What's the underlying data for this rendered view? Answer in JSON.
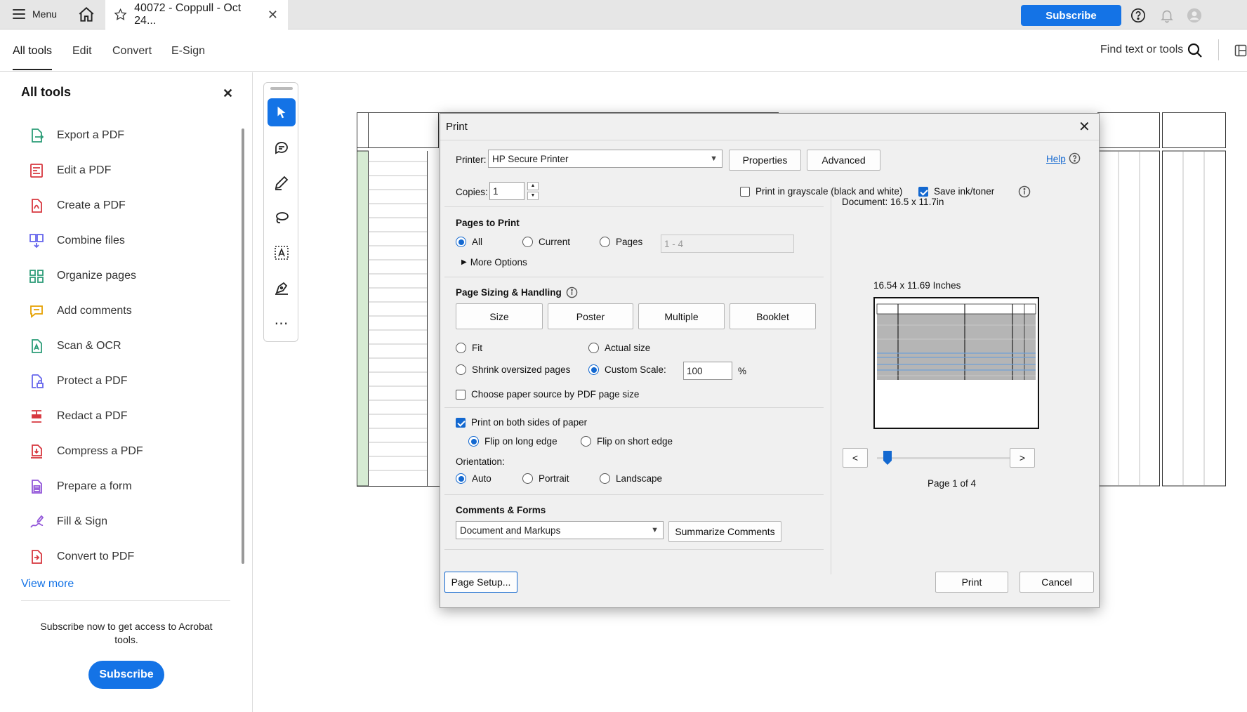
{
  "topbar": {
    "menu_label": "Menu",
    "tab_title": "40072 - Coppull - Oct 24...",
    "subscribe_label": "Subscribe"
  },
  "nav": {
    "tabs": [
      "All tools",
      "Edit",
      "Convert",
      "E-Sign"
    ],
    "active_tab": "All tools",
    "find_text": "Find text or tools"
  },
  "left_panel": {
    "title": "All tools",
    "tools": [
      {
        "label": "Export a PDF",
        "icon": "export-pdf-icon",
        "color": "#2d9d78"
      },
      {
        "label": "Edit a PDF",
        "icon": "edit-pdf-icon",
        "color": "#d7373f"
      },
      {
        "label": "Create a PDF",
        "icon": "create-pdf-icon",
        "color": "#d7373f"
      },
      {
        "label": "Combine files",
        "icon": "combine-files-icon",
        "color": "#6767ec"
      },
      {
        "label": "Organize pages",
        "icon": "organize-pages-icon",
        "color": "#2d9d78"
      },
      {
        "label": "Add comments",
        "icon": "add-comments-icon",
        "color": "#e6a100"
      },
      {
        "label": "Scan & OCR",
        "icon": "scan-ocr-icon",
        "color": "#2d9d78"
      },
      {
        "label": "Protect a PDF",
        "icon": "protect-pdf-icon",
        "color": "#6767ec"
      },
      {
        "label": "Redact a PDF",
        "icon": "redact-pdf-icon",
        "color": "#d7373f"
      },
      {
        "label": "Compress a PDF",
        "icon": "compress-pdf-icon",
        "color": "#d7373f"
      },
      {
        "label": "Prepare a form",
        "icon": "prepare-form-icon",
        "color": "#9256d9"
      },
      {
        "label": "Fill & Sign",
        "icon": "fill-sign-icon",
        "color": "#9256d9"
      },
      {
        "label": "Convert to PDF",
        "icon": "convert-to-pdf-icon",
        "color": "#d7373f"
      }
    ],
    "view_more": "View more",
    "subscribe_msg": "Subscribe now to get access to Acrobat tools.",
    "subscribe_label": "Subscribe"
  },
  "print_dialog": {
    "title": "Print",
    "printer_label": "Printer:",
    "printer_value": "HP Secure Printer",
    "properties_label": "Properties",
    "advanced_label": "Advanced",
    "help_label": "Help",
    "copies_label": "Copies:",
    "copies_value": "1",
    "grayscale_label": "Print in grayscale (black and white)",
    "grayscale_checked": false,
    "save_ink_label": "Save ink/toner",
    "save_ink_checked": true,
    "pages_to_print": {
      "title": "Pages to Print",
      "options": [
        "All",
        "Current",
        "Pages"
      ],
      "selected": "All",
      "pages_placeholder": "1 - 4",
      "more_options": "More Options"
    },
    "sizing": {
      "title": "Page Sizing & Handling",
      "buttons": [
        "Size",
        "Poster",
        "Multiple",
        "Booklet"
      ],
      "fit": "Fit",
      "actual_size": "Actual size",
      "shrink": "Shrink oversized pages",
      "custom_scale": "Custom Scale:",
      "custom_scale_value": "100",
      "percent": "%",
      "paper_source": "Choose paper source by PDF page size",
      "selected": "Custom Scale:"
    },
    "duplex": {
      "both_sides": "Print on both sides of paper",
      "both_sides_checked": true,
      "flip_long": "Flip on long edge",
      "flip_short": "Flip on short edge",
      "selected": "Flip on long edge"
    },
    "orientation": {
      "label": "Orientation:",
      "options": [
        "Auto",
        "Portrait",
        "Landscape"
      ],
      "selected": "Auto"
    },
    "comments": {
      "title": "Comments & Forms",
      "value": "Document and Markups",
      "summarize": "Summarize Comments"
    },
    "preview": {
      "document_size": "Document: 16.5 x 11.7in",
      "paper_size": "16.54 x 11.69 Inches",
      "prev": "<",
      "next": ">",
      "page_indicator": "Page 1 of 4",
      "page_slider_fraction": 0
    },
    "page_setup": "Page Setup...",
    "print": "Print",
    "cancel": "Cancel"
  }
}
